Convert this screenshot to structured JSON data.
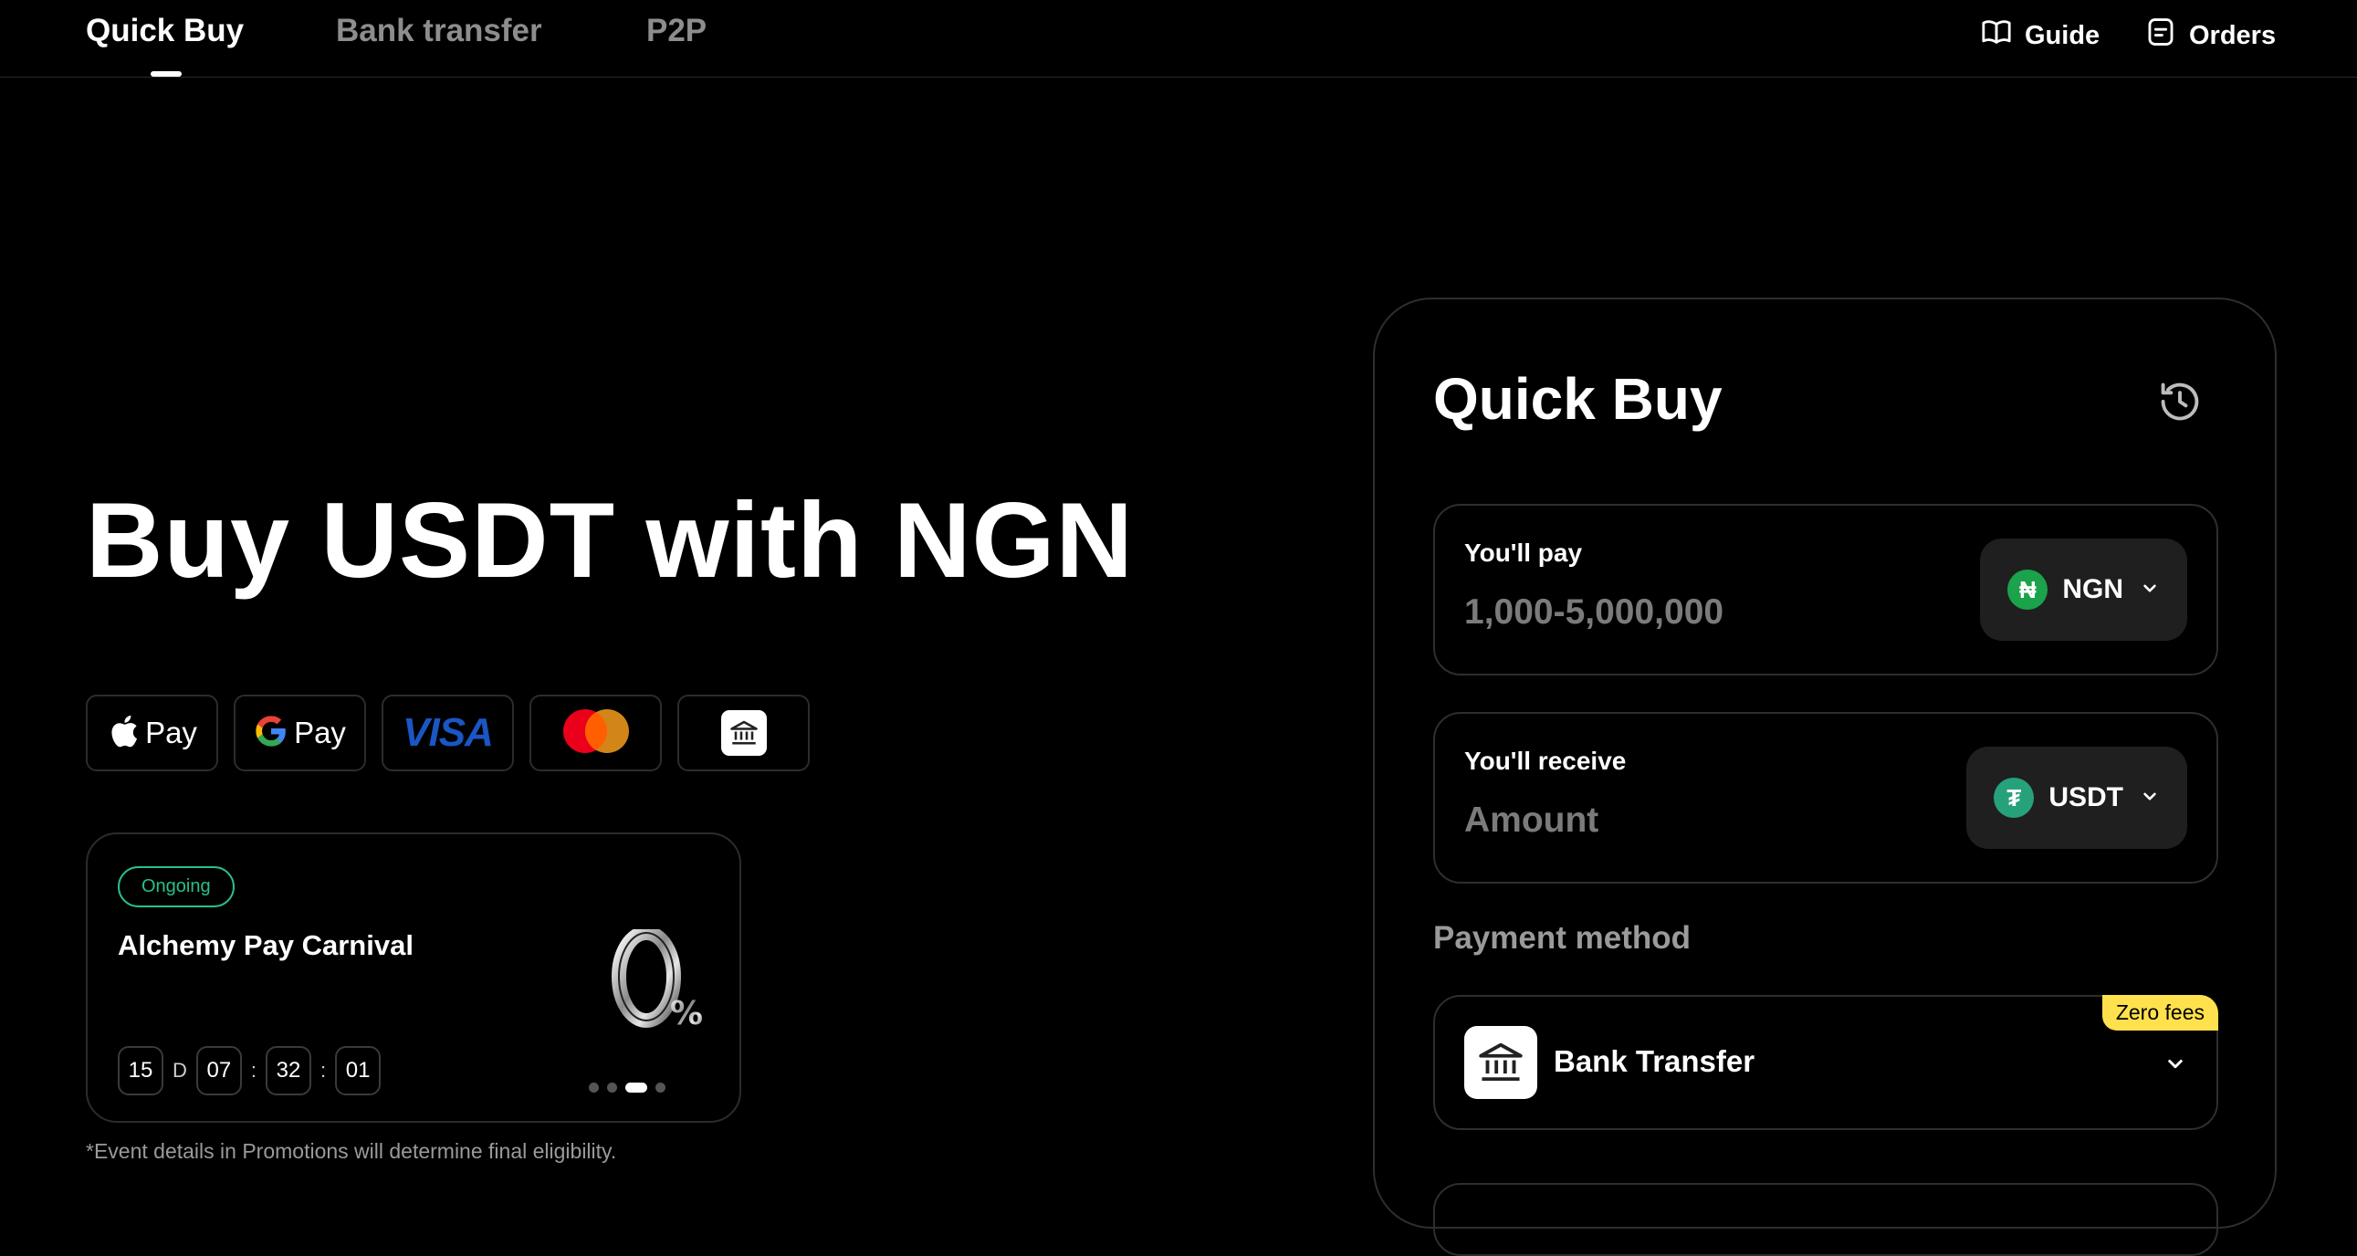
{
  "nav": {
    "tabs": [
      {
        "label": "Quick Buy",
        "active": true
      },
      {
        "label": "Bank transfer",
        "active": false
      },
      {
        "label": "P2P",
        "active": false
      }
    ],
    "guide_label": "Guide",
    "orders_label": "Orders"
  },
  "hero": {
    "title": "Buy USDT with NGN",
    "payment_methods": [
      {
        "icon": "apple-icon",
        "label": "Pay"
      },
      {
        "icon": "google-icon",
        "label": "Pay"
      },
      {
        "icon": "visa-logo",
        "label": "VISA"
      },
      {
        "icon": "mastercard-logo",
        "label": ""
      },
      {
        "icon": "bank-icon",
        "label": ""
      }
    ]
  },
  "promo": {
    "status": "Ongoing",
    "title": "Alchemy Pay Carnival",
    "countdown": {
      "days": "15",
      "day_unit": "D",
      "hours": "07",
      "minutes": "32",
      "seconds": "01",
      "separator": ":"
    },
    "carousel_active_index": 2,
    "carousel_count": 4
  },
  "disclaimer": "*Event details in Promotions will determine final eligibility.",
  "quick_buy": {
    "title": "Quick Buy",
    "pay": {
      "label": "You'll pay",
      "placeholder": "1,000-5,000,000",
      "currency": "NGN",
      "currency_symbol": "₦",
      "currency_color": "#1aa34a"
    },
    "receive": {
      "label": "You'll receive",
      "placeholder": "Amount",
      "currency": "USDT",
      "currency_symbol": "₮",
      "currency_color": "#26a17b"
    },
    "payment_method_label": "Payment method",
    "selected_method": {
      "name": "Bank Transfer",
      "badge": "Zero fees",
      "badge_color": "#ffe14d"
    }
  }
}
